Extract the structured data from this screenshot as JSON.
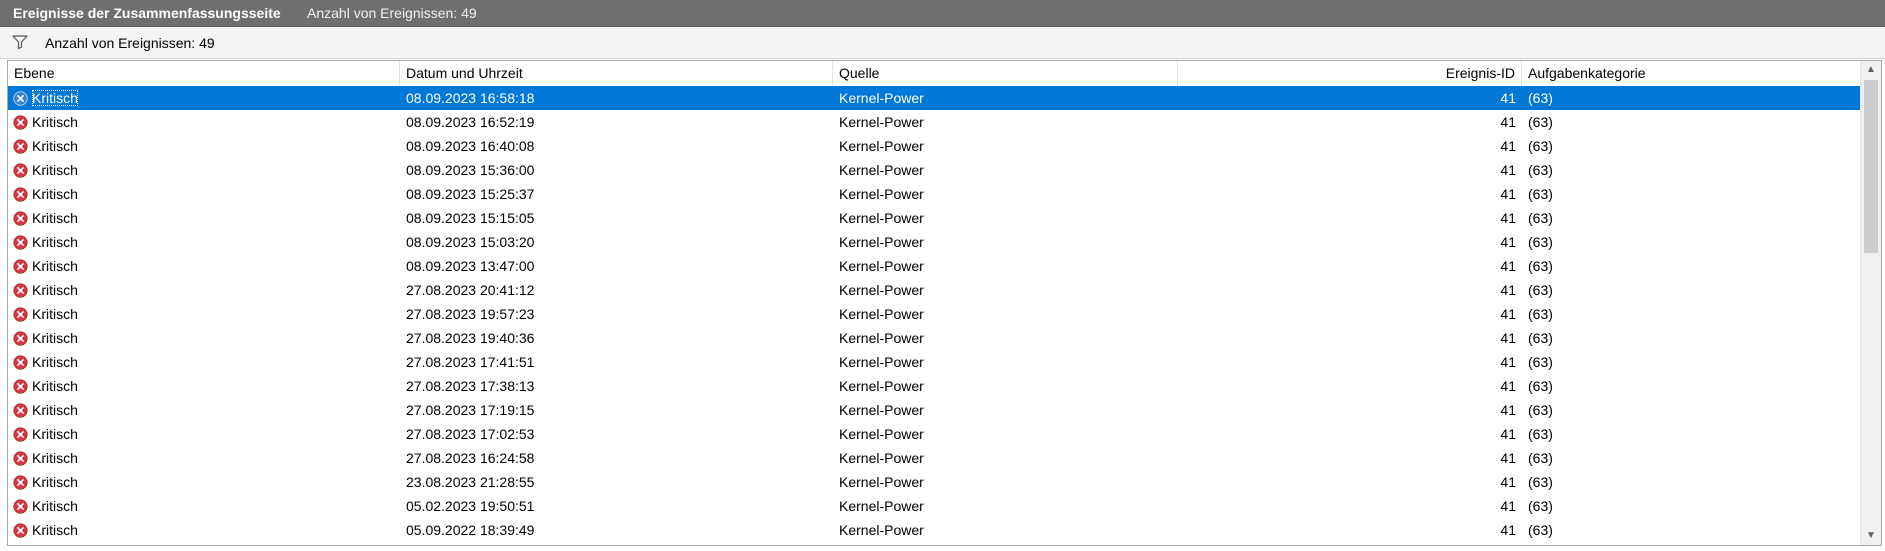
{
  "panel": {
    "title": "Ereignisse der Zusammenfassungsseite",
    "count_label": "Anzahl von Ereignissen: 49"
  },
  "filter": {
    "icon": "filter-icon",
    "text": "Anzahl von Ereignissen: 49"
  },
  "columns": {
    "level": "Ebene",
    "datetime": "Datum und Uhrzeit",
    "source": "Quelle",
    "event_id": "Ereignis-ID",
    "category": "Aufgabenkategorie"
  },
  "colors": {
    "selection": "#0078d7",
    "critical_icon": "#d9363e",
    "titlebar": "#6f6f6f"
  },
  "rows": [
    {
      "level": "Kritisch",
      "datetime": "08.09.2023 16:58:18",
      "source": "Kernel-Power",
      "event_id": "41",
      "category": "(63)",
      "selected": true
    },
    {
      "level": "Kritisch",
      "datetime": "08.09.2023 16:52:19",
      "source": "Kernel-Power",
      "event_id": "41",
      "category": "(63)"
    },
    {
      "level": "Kritisch",
      "datetime": "08.09.2023 16:40:08",
      "source": "Kernel-Power",
      "event_id": "41",
      "category": "(63)"
    },
    {
      "level": "Kritisch",
      "datetime": "08.09.2023 15:36:00",
      "source": "Kernel-Power",
      "event_id": "41",
      "category": "(63)"
    },
    {
      "level": "Kritisch",
      "datetime": "08.09.2023 15:25:37",
      "source": "Kernel-Power",
      "event_id": "41",
      "category": "(63)"
    },
    {
      "level": "Kritisch",
      "datetime": "08.09.2023 15:15:05",
      "source": "Kernel-Power",
      "event_id": "41",
      "category": "(63)"
    },
    {
      "level": "Kritisch",
      "datetime": "08.09.2023 15:03:20",
      "source": "Kernel-Power",
      "event_id": "41",
      "category": "(63)"
    },
    {
      "level": "Kritisch",
      "datetime": "08.09.2023 13:47:00",
      "source": "Kernel-Power",
      "event_id": "41",
      "category": "(63)"
    },
    {
      "level": "Kritisch",
      "datetime": "27.08.2023 20:41:12",
      "source": "Kernel-Power",
      "event_id": "41",
      "category": "(63)"
    },
    {
      "level": "Kritisch",
      "datetime": "27.08.2023 19:57:23",
      "source": "Kernel-Power",
      "event_id": "41",
      "category": "(63)"
    },
    {
      "level": "Kritisch",
      "datetime": "27.08.2023 19:40:36",
      "source": "Kernel-Power",
      "event_id": "41",
      "category": "(63)"
    },
    {
      "level": "Kritisch",
      "datetime": "27.08.2023 17:41:51",
      "source": "Kernel-Power",
      "event_id": "41",
      "category": "(63)"
    },
    {
      "level": "Kritisch",
      "datetime": "27.08.2023 17:38:13",
      "source": "Kernel-Power",
      "event_id": "41",
      "category": "(63)"
    },
    {
      "level": "Kritisch",
      "datetime": "27.08.2023 17:19:15",
      "source": "Kernel-Power",
      "event_id": "41",
      "category": "(63)"
    },
    {
      "level": "Kritisch",
      "datetime": "27.08.2023 17:02:53",
      "source": "Kernel-Power",
      "event_id": "41",
      "category": "(63)"
    },
    {
      "level": "Kritisch",
      "datetime": "27.08.2023 16:24:58",
      "source": "Kernel-Power",
      "event_id": "41",
      "category": "(63)"
    },
    {
      "level": "Kritisch",
      "datetime": "23.08.2023 21:28:55",
      "source": "Kernel-Power",
      "event_id": "41",
      "category": "(63)"
    },
    {
      "level": "Kritisch",
      "datetime": "05.02.2023 19:50:51",
      "source": "Kernel-Power",
      "event_id": "41",
      "category": "(63)"
    },
    {
      "level": "Kritisch",
      "datetime": "05.09.2022 18:39:49",
      "source": "Kernel-Power",
      "event_id": "41",
      "category": "(63)"
    }
  ]
}
